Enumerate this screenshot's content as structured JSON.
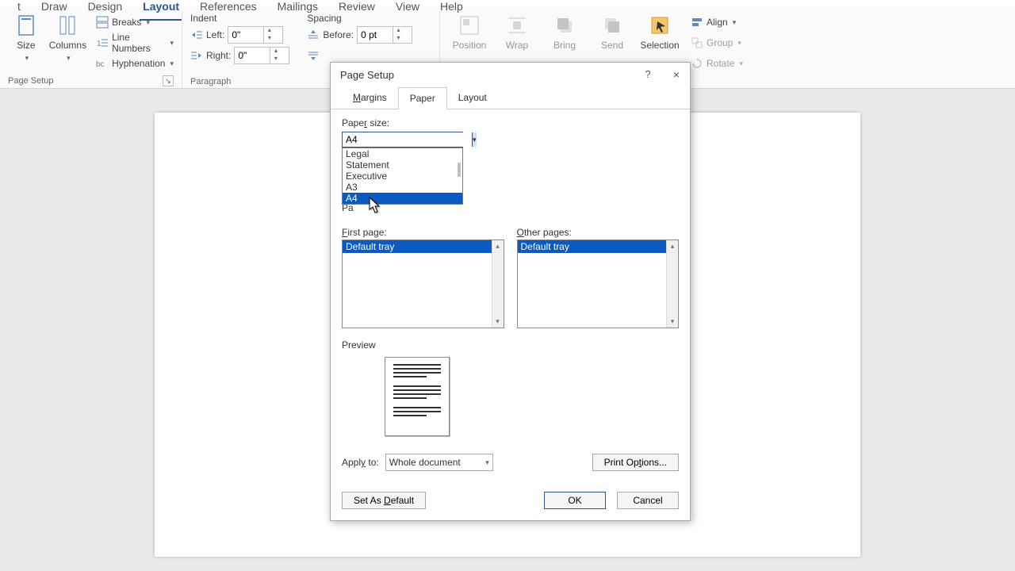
{
  "ribbon": {
    "tabs": [
      "t",
      "Draw",
      "Design",
      "Layout",
      "References",
      "Mailings",
      "Review",
      "View",
      "Help"
    ],
    "active_tab": "Layout",
    "page_setup": {
      "size": "Size",
      "columns": "Columns",
      "breaks": "Breaks",
      "line_numbers": "Line Numbers",
      "hyphenation": "Hyphenation",
      "group_label": "Page Setup"
    },
    "paragraph": {
      "indent_label": "Indent",
      "left_label": "Left:",
      "right_label": "Right:",
      "left_value": "0\"",
      "right_value": "0\"",
      "spacing_label": "Spacing",
      "before_label": "Before:",
      "before_value": "0 pt",
      "group_label": "Paragraph"
    },
    "arrange": {
      "position": "Position",
      "wrap": "Wrap",
      "bring": "Bring",
      "send": "Send",
      "selection": "Selection",
      "align": "Align",
      "group": "Group",
      "rotate": "Rotate"
    }
  },
  "dialog": {
    "title": "Page Setup",
    "tabs": {
      "margins": "Margins",
      "paper": "Paper",
      "layout": "Layout"
    },
    "paper_size_label": "Paper size:",
    "paper_size_value": "A4",
    "paper_size_options": [
      "Legal",
      "Statement",
      "Executive",
      "A3",
      "A4"
    ],
    "paper_size_selected": "A4",
    "paper_source_hidden": "Pa",
    "first_page_label": "First page:",
    "other_pages_label": "Other pages:",
    "tray_first": "Default tray",
    "tray_other": "Default tray",
    "preview_label": "Preview",
    "apply_to_label": "Apply to:",
    "apply_to_value": "Whole document",
    "print_options": "Print Options...",
    "set_default": "Set As Default",
    "ok": "OK",
    "cancel": "Cancel",
    "help": "?",
    "close": "×"
  }
}
